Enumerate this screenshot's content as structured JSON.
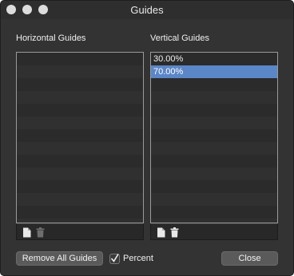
{
  "window": {
    "title": "Guides"
  },
  "horizontal": {
    "label": "Horizontal Guides",
    "items": []
  },
  "vertical": {
    "label": "Vertical Guides",
    "items": [
      {
        "label": "30.00%",
        "selected": false
      },
      {
        "label": "70.00%",
        "selected": true
      }
    ]
  },
  "footer_icons": {
    "add": "new-document-icon",
    "delete": "trash-icon"
  },
  "buttons": {
    "remove_all": "Remove All Guides",
    "close": "Close"
  },
  "percent": {
    "label": "Percent",
    "checked": true
  },
  "colors": {
    "selection": "#5b86c7",
    "window_bg": "#333333"
  }
}
